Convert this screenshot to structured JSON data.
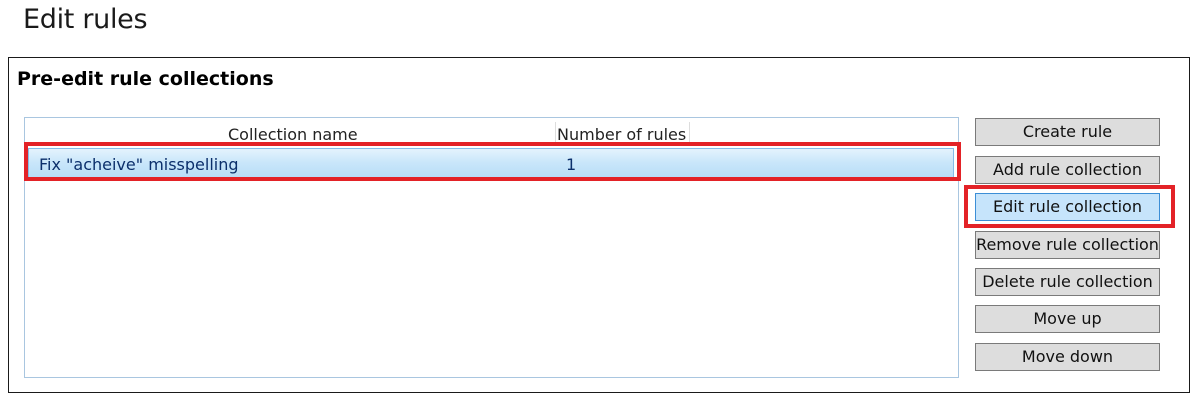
{
  "page": {
    "title": "Edit rules"
  },
  "section": {
    "title": "Pre-edit rule collections"
  },
  "table": {
    "columns": [
      "Collection name",
      "Number of rules"
    ],
    "rows": [
      {
        "name": "Fix \"acheive\" misspelling",
        "count": "1",
        "selected": true
      }
    ]
  },
  "buttons": {
    "create_rule": "Create rule",
    "add_rule_collection": "Add rule collection",
    "edit_rule_collection": "Edit rule collection",
    "remove_rule_collection": "Remove rule collection",
    "delete_rule_collection": "Delete rule collection",
    "move_up": "Move up",
    "move_down": "Move down"
  },
  "colors": {
    "highlight": "#e32227",
    "selection": "#c9e6fa",
    "active_button": "#c6e4fb"
  }
}
